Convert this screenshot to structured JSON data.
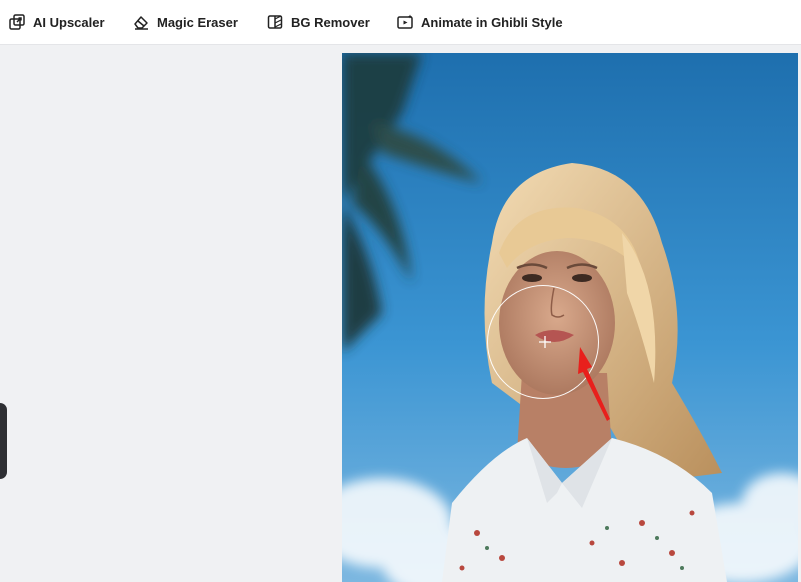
{
  "toolbar": {
    "items": [
      {
        "label": "AI Upscaler",
        "icon": "upscale-icon"
      },
      {
        "label": "Magic Eraser",
        "icon": "eraser-icon"
      },
      {
        "label": "BG Remover",
        "icon": "bg-remover-icon"
      },
      {
        "label": "Animate in Ghibli Style",
        "icon": "animate-icon"
      }
    ]
  },
  "canvas": {
    "image": "portrait-photo",
    "cursor": "brush-crosshair",
    "annotation": "red-arrow"
  },
  "colors": {
    "toolbar_bg": "#ffffff",
    "page_bg": "#f0f1f3",
    "text": "#222222",
    "arrow": "#e8201c",
    "sky": "#2f86c6"
  }
}
